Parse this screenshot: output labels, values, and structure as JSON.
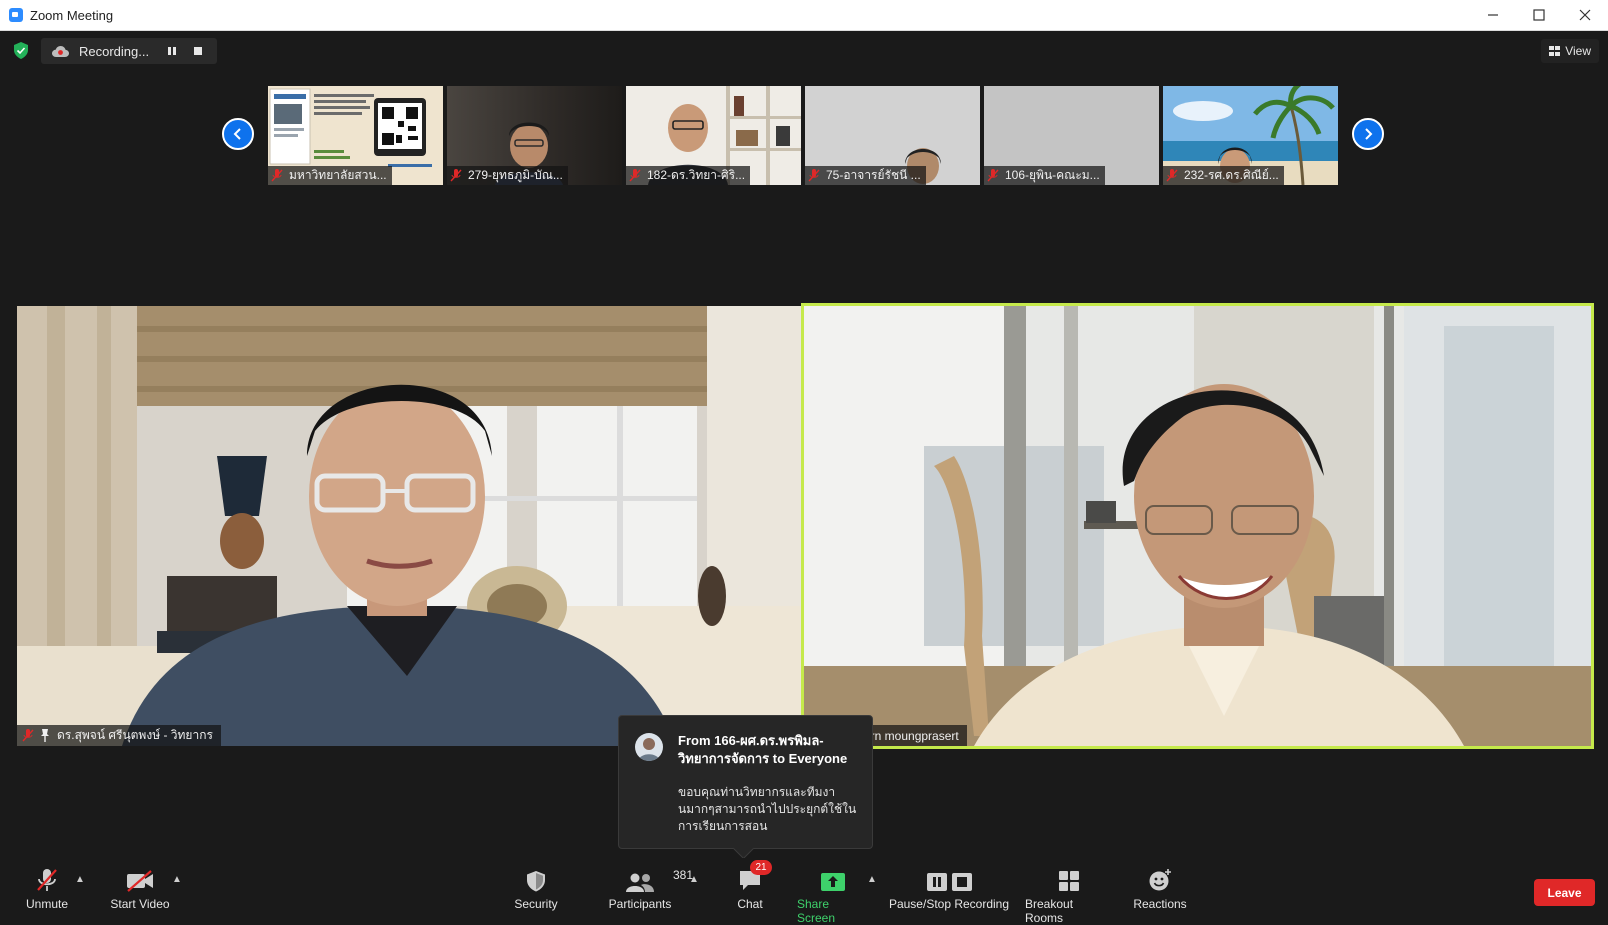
{
  "window": {
    "title": "Zoom Meeting"
  },
  "recording": {
    "label": "Recording..."
  },
  "view": {
    "label": "View"
  },
  "thumbnails": [
    {
      "name": "มหาวิทยาลัยสวน..."
    },
    {
      "name": "279-ยุทธภูมิ-บัณ..."
    },
    {
      "name": "182-ดร.วิทยา-ศิริ..."
    },
    {
      "name": "75-อาจารย์รัชนี ..."
    },
    {
      "name": "106-ยุพิน-คณะม..."
    },
    {
      "name": "232-รศ.ดร.ศิณีย์..."
    }
  ],
  "speakers": {
    "left": {
      "name": "ดร.สุพจน์ ศรีนุตพงษ์ - วิทยากร"
    },
    "right": {
      "name": "arn moungprasert"
    }
  },
  "chat_popup": {
    "from": "From 166-ผศ.ดร.พรพิมล-วิทยาการจัดการ to Everyone",
    "message": "ขอบคุณท่านวิทยากรและทีมงานมากๆสามารถนำไปประยุกต์ใช้ในการเรียนการสอน"
  },
  "toolbar": {
    "unmute": "Unmute",
    "start_video": "Start Video",
    "security": "Security",
    "participants": "Participants",
    "participants_count": "381",
    "chat": "Chat",
    "chat_badge": "21",
    "share_screen": "Share Screen",
    "pause_stop_recording": "Pause/Stop Recording",
    "breakout_rooms": "Breakout Rooms",
    "reactions": "Reactions",
    "leave": "Leave"
  },
  "colors": {
    "accent_blue": "#0e72ed",
    "active_speaker_border": "#c5e94b",
    "share_green": "#3ed16b",
    "leave_red": "#e02828",
    "muted_red": "#e02828"
  }
}
